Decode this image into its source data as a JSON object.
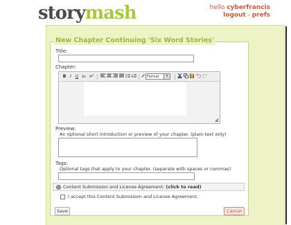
{
  "brand": {
    "part1": "story",
    "part2": "mash"
  },
  "user": {
    "greeting": "hello",
    "username": "cyberfrancis",
    "logout": "logout",
    "separator": "-",
    "prefs": "prefs"
  },
  "form": {
    "legend": "New Chapter Continuing 'Six Word Stories'",
    "title_label": "Title:",
    "chapter_label": "Chapter:",
    "toolbar": {
      "bold": "B",
      "italic": "I",
      "underline": "U",
      "subscript": "x₂",
      "superscript": "x²",
      "format_select": "Format",
      "items": [
        "align-left-icon",
        "align-center-icon",
        "align-right-icon",
        "align-justify-icon",
        "bullet-list-icon",
        "numbered-list-icon",
        "outdent-icon",
        "indent-icon",
        "cut-icon",
        "copy-icon",
        "paste-icon",
        "undo-icon",
        "redo-icon"
      ]
    },
    "preview_label": "Preview:",
    "preview_help": "An optional short introduction or preview of your chapter. (plain text only)",
    "tags_label": "Tags:",
    "tags_help": "Optional tags that apply to your chapter. (separate with spaces or commas)",
    "agreement_text": "Content Submission and License Agreement:",
    "agreement_link": "(click to read)",
    "accept_label": "I accept this Content Submission and License Agreement.",
    "save_label": "Save",
    "cancel_label": "Cancel"
  },
  "colors": {
    "accent_green": "#a1b43b",
    "panel_bg": "#eef3c6",
    "link_red": "#c85a3c"
  }
}
